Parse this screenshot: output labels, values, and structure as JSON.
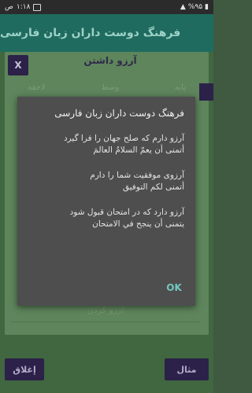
{
  "status_bar": {
    "time": "۱:۱۸",
    "period": "ص",
    "battery": "%۹۵"
  },
  "app_bar": {
    "title": "فرهنگ دوست داران زبان فارسی"
  },
  "background": {
    "title": "آرزو داشتن",
    "close_x": "X",
    "radios": [
      "پایه",
      "وسط",
      "لاحقه"
    ],
    "input_placeholder": "آرزو کردن",
    "close_button": "إغلاق",
    "example_button": "مثال"
  },
  "dialog": {
    "title": "فرهنگ دوست داران زبان فارسی",
    "entries": [
      {
        "fa": "آرزو دارم که صلح جهان را فرا گیرد",
        "ar": "أتمنى أن يعمّ السلامُ العالمَ"
      },
      {
        "fa": "آرزوی موفقیت شما را دارم",
        "ar": "أتمنى لكم التوفيق"
      },
      {
        "fa": "آرزو دارد که در امتحان قبول شود",
        "ar": "يتمنى أن ينجح في الامتحان"
      }
    ],
    "ok_label": "OK"
  }
}
